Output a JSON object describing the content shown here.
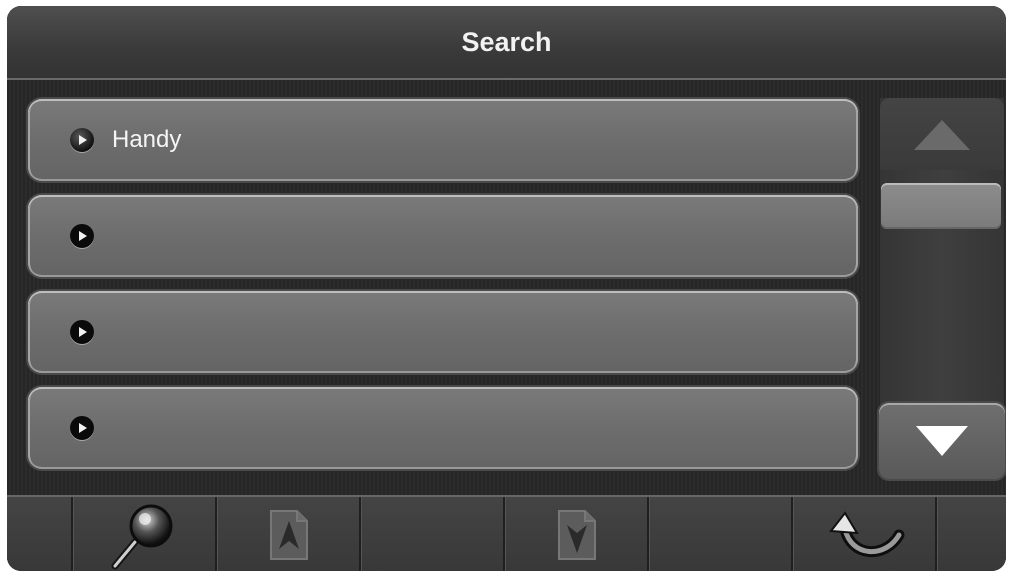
{
  "header": {
    "title": "Search"
  },
  "list": {
    "items": [
      {
        "label": "Handy"
      },
      {
        "label": ""
      },
      {
        "label": ""
      },
      {
        "label": ""
      }
    ]
  },
  "scrollbar": {
    "up_icon": "triangle-up-icon",
    "down_icon": "triangle-down-icon"
  },
  "toolbar": {
    "buttons": [
      {
        "icon": "magnifier-icon"
      },
      {
        "icon": "document-arrow-up-icon"
      },
      {
        "icon": "document-arrow-down-icon"
      },
      {
        "icon": "rotate-back-icon"
      }
    ]
  },
  "colors": {
    "background": "#2e2e2e",
    "row": "#707070",
    "text": "#f2f2f2"
  }
}
